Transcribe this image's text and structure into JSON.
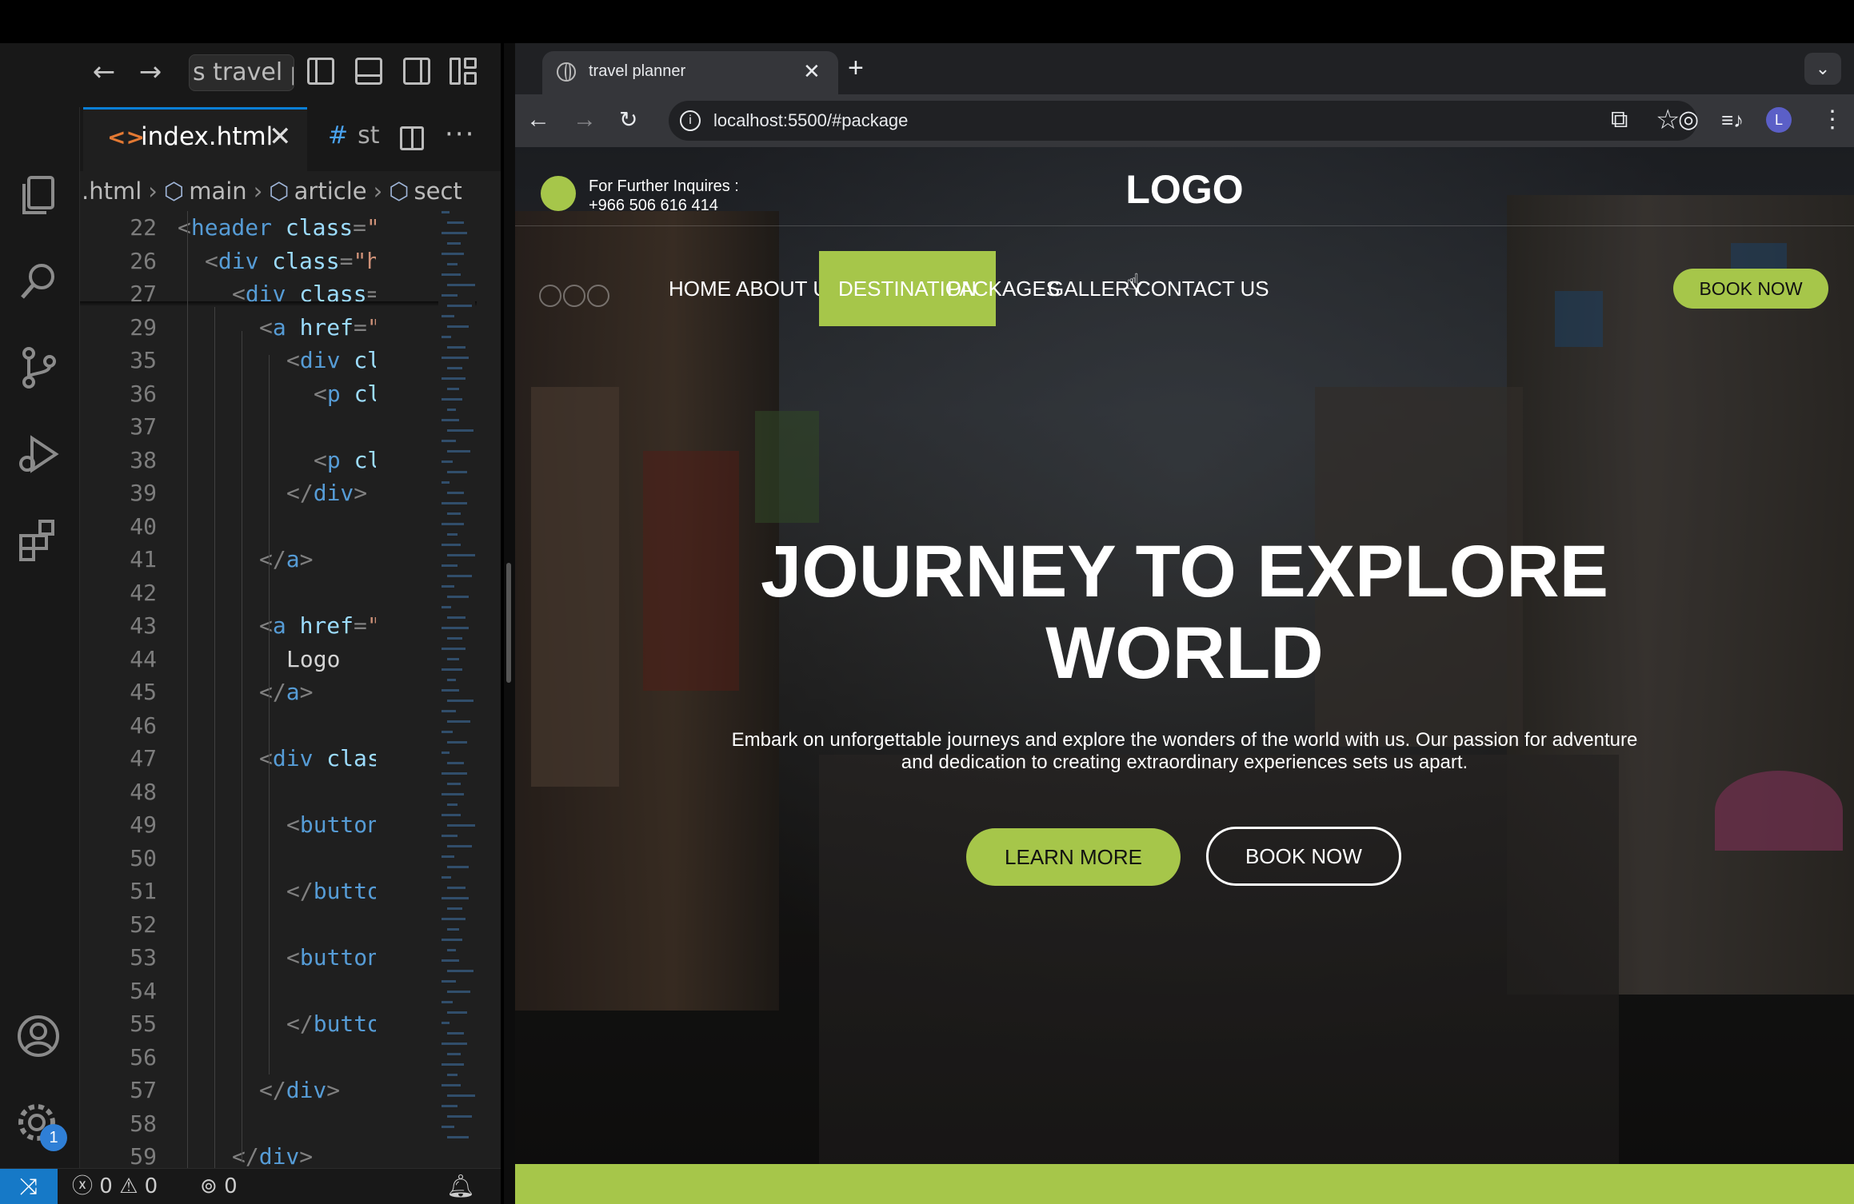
{
  "vscode": {
    "search_text": "s travel pl",
    "tab_active": "index.html",
    "tab_second": "st",
    "breadcrumb": [
      ".html",
      "main",
      "article",
      "sect"
    ],
    "badge_count": "1",
    "status": {
      "errors": "0",
      "warnings": "0",
      "ports": "0"
    },
    "lines": [
      {
        "n": "22",
        "indent": 0,
        "html": "<span class='punc'>&lt;</span><span class='tag'>header</span> <span class='attr'>class</span><span class='punc'>=</span><span class='str'>\"hea</span>"
      },
      {
        "n": "26",
        "indent": 1,
        "html": "<span class='punc'>&lt;</span><span class='tag'>div</span> <span class='attr'>class</span><span class='punc'>=</span><span class='str'>\"head</span>"
      },
      {
        "n": "27",
        "indent": 2,
        "html": "<span class='punc'>&lt;</span><span class='tag'>div</span> <span class='attr'>class</span><span class='punc'>=</span><span class='str'>\"co</span>"
      },
      {
        "n": "29",
        "indent": 3,
        "html": "<span class='punc'>&lt;</span><span class='tag'>a</span> <span class='attr'>href</span><span class='punc'>=</span><span class='str'>\"tel</span>"
      },
      {
        "n": "35",
        "indent": 4,
        "html": "<span class='punc'>&lt;</span><span class='tag'>div</span> <span class='attr'>class</span>"
      },
      {
        "n": "36",
        "indent": 5,
        "html": "<span class='punc'>&lt;</span><span class='tag'>p</span> <span class='attr'>class</span>"
      },
      {
        "n": "37",
        "indent": 0,
        "html": ""
      },
      {
        "n": "38",
        "indent": 5,
        "html": "<span class='punc'>&lt;</span><span class='tag'>p</span> <span class='attr'>class</span>"
      },
      {
        "n": "39",
        "indent": 4,
        "html": "<span class='punc'>&lt;/</span><span class='tag'>div</span><span class='punc'>&gt;</span>"
      },
      {
        "n": "40",
        "indent": 0,
        "html": ""
      },
      {
        "n": "41",
        "indent": 3,
        "html": "<span class='punc'>&lt;/</span><span class='tag'>a</span><span class='punc'>&gt;</span>"
      },
      {
        "n": "42",
        "indent": 0,
        "html": ""
      },
      {
        "n": "43",
        "indent": 3,
        "html": "<span class='punc'>&lt;</span><span class='tag'>a</span> <span class='attr'>href</span><span class='punc'>=</span><span class='str'>\"#\"</span>"
      },
      {
        "n": "44",
        "indent": 4,
        "html": "<span class='txt'>Logo</span>"
      },
      {
        "n": "45",
        "indent": 3,
        "html": "<span class='punc'>&lt;/</span><span class='tag'>a</span><span class='punc'>&gt;</span>"
      },
      {
        "n": "46",
        "indent": 0,
        "html": ""
      },
      {
        "n": "47",
        "indent": 3,
        "html": "<span class='punc'>&lt;</span><span class='tag'>div</span> <span class='attr'>class</span><span class='punc'>=</span><span class='str'>\"</span>"
      },
      {
        "n": "48",
        "indent": 0,
        "html": ""
      },
      {
        "n": "49",
        "indent": 4,
        "html": "<span class='punc'>&lt;</span><span class='tag'>button</span> <span class='attr'>cl</span>"
      },
      {
        "n": "50",
        "indent": 0,
        "html": ""
      },
      {
        "n": "51",
        "indent": 4,
        "html": "<span class='punc'>&lt;/</span><span class='tag'>button</span><span class='punc'>&gt;</span>"
      },
      {
        "n": "52",
        "indent": 0,
        "html": ""
      },
      {
        "n": "53",
        "indent": 4,
        "html": "<span class='punc'>&lt;</span><span class='tag'>button</span> <span class='attr'>cl</span>"
      },
      {
        "n": "54",
        "indent": 0,
        "html": ""
      },
      {
        "n": "55",
        "indent": 4,
        "html": "<span class='punc'>&lt;/</span><span class='tag'>button</span><span class='punc'>&gt;</span>"
      },
      {
        "n": "56",
        "indent": 0,
        "html": ""
      },
      {
        "n": "57",
        "indent": 3,
        "html": "<span class='punc'>&lt;/</span><span class='tag'>div</span><span class='punc'>&gt;</span>"
      },
      {
        "n": "58",
        "indent": 0,
        "html": ""
      },
      {
        "n": "59",
        "indent": 2,
        "html": "<span class='punc'>&lt;/</span><span class='tag'>div</span><span class='punc'>&gt;</span>"
      }
    ]
  },
  "browser": {
    "tab_title": "travel planner",
    "url": "localhost:5500/#package",
    "profile_initial": "L"
  },
  "site": {
    "contact_label": "For Further Inquires :",
    "contact_phone": "+966 506 616 414",
    "logo": "LOGO",
    "nav": [
      "HOME",
      "ABOUT US",
      "DESTINATION",
      "PACKAGES",
      "GALLERY",
      "CONTACT US"
    ],
    "active_nav": "DESTINATION",
    "book_top": "BOOK NOW",
    "hero_line1": "JOURNEY TO EXPLORE",
    "hero_line2": "WORLD",
    "hero_sub_line1": "Embark on unforgettable journeys and explore the wonders of the world with us. Our passion for adventure",
    "hero_sub_line2": "and dedication to creating extraordinary experiences sets us apart.",
    "learn_more": "LEARN MORE",
    "book_now": "BOOK NOW",
    "accent": "#a6c64a"
  }
}
